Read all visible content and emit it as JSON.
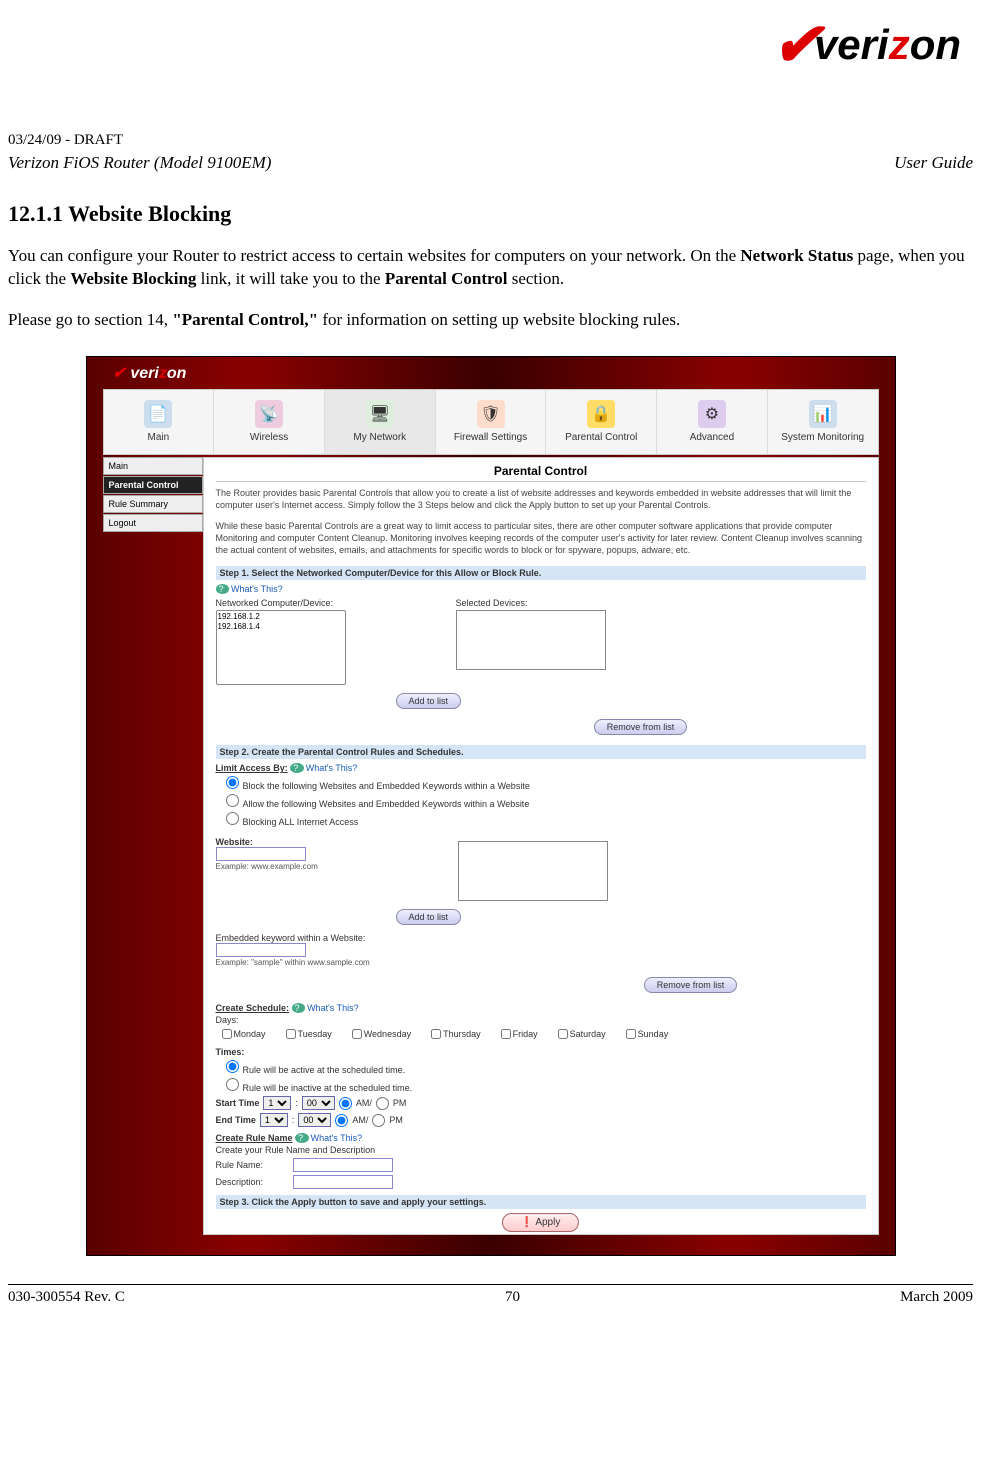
{
  "header": {
    "draft": "03/24/09 - DRAFT",
    "product": "Verizon FiOS Router (Model 9100EM)",
    "doc_type": "User Guide",
    "logo_brand": "verizon",
    "logo_accent": "z"
  },
  "section": {
    "number_title": "12.1.1 Website Blocking",
    "para1_a": "You can configure your Router to restrict access to certain websites for computers on your network. On the ",
    "para1_b1": "Network Status",
    "para1_c": " page, when you click the ",
    "para1_b2": "Website Blocking",
    "para1_d": " link, it will take you to the ",
    "para1_b3": "Parental Control",
    "para1_e": " section.",
    "para2_a": "Please go to section 14, ",
    "para2_b": "\"Parental Control,\"",
    "para2_c": " for information on setting up website blocking rules."
  },
  "screenshot": {
    "logo_text": "verizon",
    "logo_accent": "z",
    "nav": [
      {
        "label": "Main",
        "glyph": "📄"
      },
      {
        "label": "Wireless",
        "glyph": "📡"
      },
      {
        "label": "My Network",
        "glyph": "🖥"
      },
      {
        "label": "Firewall Settings",
        "glyph": "🛡"
      },
      {
        "label": "Parental Control",
        "glyph": "🔒"
      },
      {
        "label": "Advanced",
        "glyph": "⚙"
      },
      {
        "label": "System Monitoring",
        "glyph": "📊"
      }
    ],
    "sidebar": [
      {
        "label": "Main",
        "selected": false
      },
      {
        "label": "Parental Control",
        "selected": true
      },
      {
        "label": "Rule Summary",
        "selected": false
      },
      {
        "label": "Logout",
        "selected": false
      }
    ],
    "panel": {
      "title": "Parental Control",
      "intro1": "The Router provides basic Parental Controls that allow you to create a list of website addresses and keywords embedded in website addresses that will limit the computer user's Internet access. Simply follow the 3 Steps below and click the Apply button to set up your Parental Controls.",
      "intro2": "While these basic Parental Controls are a great way to limit access to particular sites, there are other computer software applications that provide computer Monitoring and computer Content Cleanup. Monitoring involves keeping records of the computer user's activity for later review. Content Cleanup involves scanning the actual content of websites, emails, and attachments for specific words to block or for spyware, popups, adware, etc.",
      "step1": "Step 1. Select the Networked Computer/Device for this Allow or Block Rule.",
      "whats_this": "What's This?",
      "devices_label": "Networked Computer/Device:",
      "selected_label": "Selected Devices:",
      "devices": [
        "192.168.1.2",
        "192.168.1.4"
      ],
      "add_to_list": "Add to list",
      "remove_from_list": "Remove from list",
      "step2": "Step 2. Create the Parental Control Rules and Schedules.",
      "limit_access": "Limit Access By:",
      "radio1": "Block the following Websites and Embedded Keywords within a Website",
      "radio2": "Allow the following Websites and Embedded Keywords within a Website",
      "radio3": "Blocking ALL Internet Access",
      "website_label": "Website:",
      "website_example": "Example: www.example.com",
      "keyword_label": "Embedded keyword within a Website:",
      "keyword_example": "Example: \"sample\" within www.sample.com",
      "create_schedule": "Create Schedule:",
      "days_label": "Days:",
      "days": [
        "Monday",
        "Tuesday",
        "Wednesday",
        "Thursday",
        "Friday",
        "Saturday",
        "Sunday"
      ],
      "times_label": "Times:",
      "time_rule_active": "Rule will be active at the scheduled time.",
      "time_rule_inactive": "Rule will be inactive at the scheduled time.",
      "start_time": "Start Time",
      "end_time": "End Time",
      "hour_opt": "1",
      "min_opt": "00",
      "am": "AM/",
      "pm": "PM",
      "create_rule_name": "Create Rule Name",
      "create_rule_desc": "Create your Rule Name and Description",
      "rule_name_lbl": "Rule Name:",
      "description_lbl": "Description:",
      "step3": "Step 3. Click the Apply button to save and apply your settings.",
      "apply": "Apply"
    }
  },
  "footer": {
    "rev": "030-300554 Rev. C",
    "page": "70",
    "date": "March 2009"
  }
}
